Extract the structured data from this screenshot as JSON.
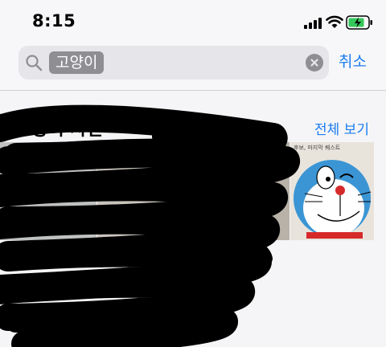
{
  "status_bar": {
    "time": "8:15",
    "icons": [
      "signal-icon",
      "wifi-icon",
      "battery-charging-icon"
    ]
  },
  "search": {
    "query_token": "고양이",
    "cancel_label": "취소"
  },
  "photos_section": {
    "title": "6장의 사진",
    "see_all_label": "전체 보기",
    "thumbnail_caption": "후보, 마지막 퀘스트"
  },
  "colors": {
    "accent": "#1b7cf0",
    "token_bg": "#8e8e93",
    "search_bg": "#e5e5ea",
    "battery_charge": "#34c759"
  }
}
